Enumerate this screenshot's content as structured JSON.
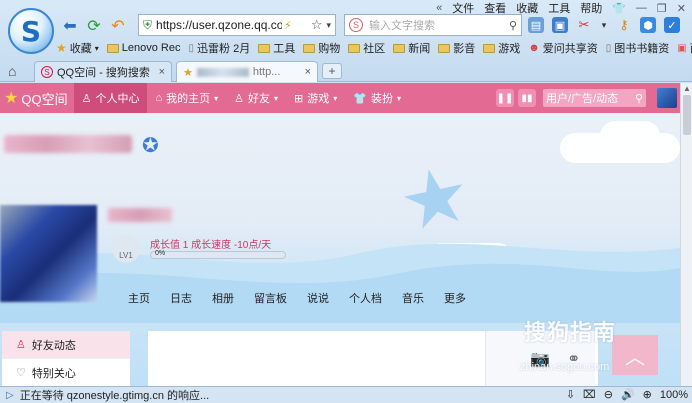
{
  "browser": {
    "logo_letter": "S",
    "menu": [
      "文件",
      "查看",
      "收藏",
      "工具",
      "帮助"
    ],
    "menu_icons": [
      "double-chevron-up-icon",
      "shirt-icon",
      "minimize-icon",
      "restore-icon",
      "close-icon"
    ],
    "address": "https://user.qzone.qq.com",
    "search_placeholder": "输入文字搜索",
    "favorites_label": "收藏",
    "bookmarks": [
      "Lenovo Rec",
      "迅雷粉 2月",
      "工具",
      "购物",
      "社区",
      "新闻",
      "影音",
      "游戏",
      "爱问共享资",
      "图书书籍资",
      "西幼"
    ],
    "tabs": [
      {
        "label": "QQ空间 - 搜狗搜索",
        "close": "×"
      },
      {
        "label": "http...",
        "close": "×"
      }
    ],
    "status_text": "正在等待 qzonestyle.gtimg.cn 的响应...",
    "zoom": "100%"
  },
  "qzone": {
    "brand": "QQ空间",
    "nav": [
      {
        "label": "个人中心",
        "icon": "person-icon"
      },
      {
        "label": "我的主页",
        "icon": "home-icon"
      },
      {
        "label": "好友",
        "icon": "friends-icon"
      },
      {
        "label": "游戏",
        "icon": "grid-icon"
      },
      {
        "label": "装扮",
        "icon": "shirt-icon"
      }
    ],
    "search_placeholder": "用户/广告/动态",
    "growth_text": "成长值 1   成长速度 -10点/天",
    "level": "LV1",
    "progress_percent": 0,
    "progress_label": "0%",
    "profile_tabs": [
      "主页",
      "日志",
      "相册",
      "留言板",
      "说说",
      "个人档",
      "音乐",
      "更多"
    ],
    "left_menu": [
      "好友动态",
      "特别关心"
    ],
    "watermark": "搜狗指南",
    "watermark_sub": "zhinan.sogou.com"
  },
  "colors": {
    "qzone_pink": "#e36a93",
    "qzone_active": "#cf4d7b",
    "chrome_blue": "#c3daef"
  }
}
